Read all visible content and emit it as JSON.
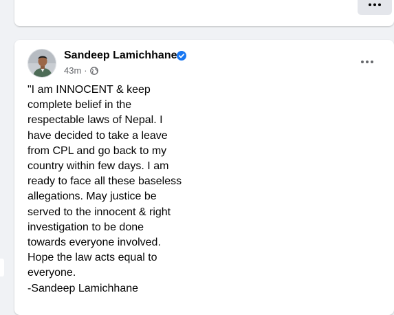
{
  "post": {
    "author": "Sandeep Lamichhane",
    "time": "43m",
    "separator": "·",
    "privacy_icon": "globe-icon",
    "verified_icon": "verified-badge-icon",
    "verified_color": "#1877f2",
    "text": "\"I am INNOCENT & keep\ncomplete belief in the\nrespectable laws of Nepal. I\nhave decided to take a leave\nfrom CPL and go back to my\ncountry within few days. I am\nready to face all these baseless\nallegations. May justice be\nserved to the innocent & right\ninvestigation to be done\ntowards everyone involved.\nHope the law acts equal to\neveryone.\n-Sandeep Lamichhane"
  },
  "icons": {
    "top_more": "more-options-icon",
    "post_more": "more-options-icon"
  }
}
